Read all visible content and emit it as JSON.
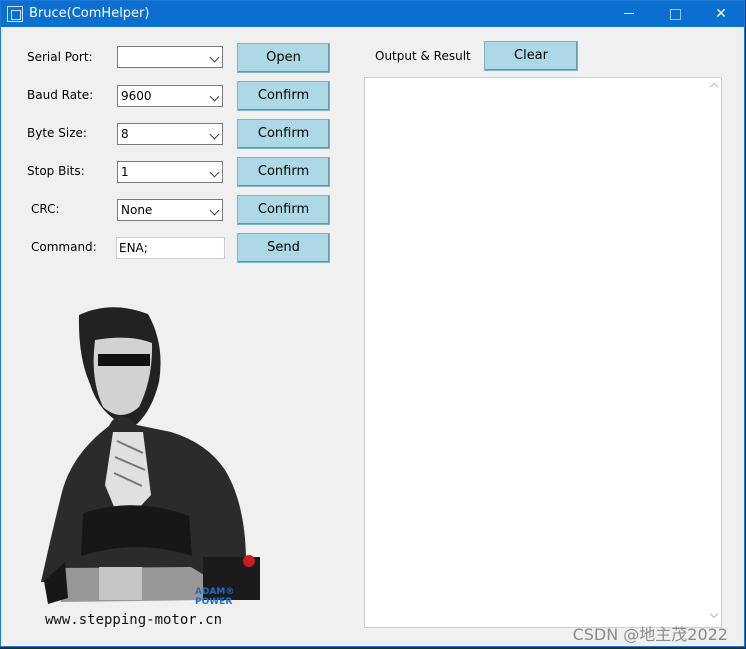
{
  "window": {
    "title": "Bruce(ComHelper)",
    "minimize_icon": "minimize-icon",
    "maximize_icon": "maximize-icon",
    "close_icon": "close-icon",
    "close_label": "✕"
  },
  "settings": {
    "serial_port": {
      "label": "Serial Port:",
      "value": "",
      "button": "Open"
    },
    "baud_rate": {
      "label": "Baud Rate:",
      "value": "9600",
      "button": "Confirm"
    },
    "byte_size": {
      "label": "Byte Size:",
      "value": "8",
      "button": "Confirm"
    },
    "stop_bits": {
      "label": "Stop Bits:",
      "value": "1",
      "button": "Confirm"
    },
    "crc": {
      "label": "CRC:",
      "value": "None",
      "button": "Confirm"
    },
    "command": {
      "label": "Command:",
      "value": "ENA;",
      "button": "Send"
    }
  },
  "output": {
    "label": "Output & Result",
    "clear_button": "Clear",
    "content": ""
  },
  "branding": {
    "website": "www.stepping-motor.cn",
    "logo_top": "ADAM®",
    "logo_bottom": "POWER"
  },
  "watermark": "CSDN @地主茂2022",
  "colors": {
    "titlebar": "#0a6fd0",
    "button": "#add8e6",
    "window_bg": "#f0f0f0"
  }
}
